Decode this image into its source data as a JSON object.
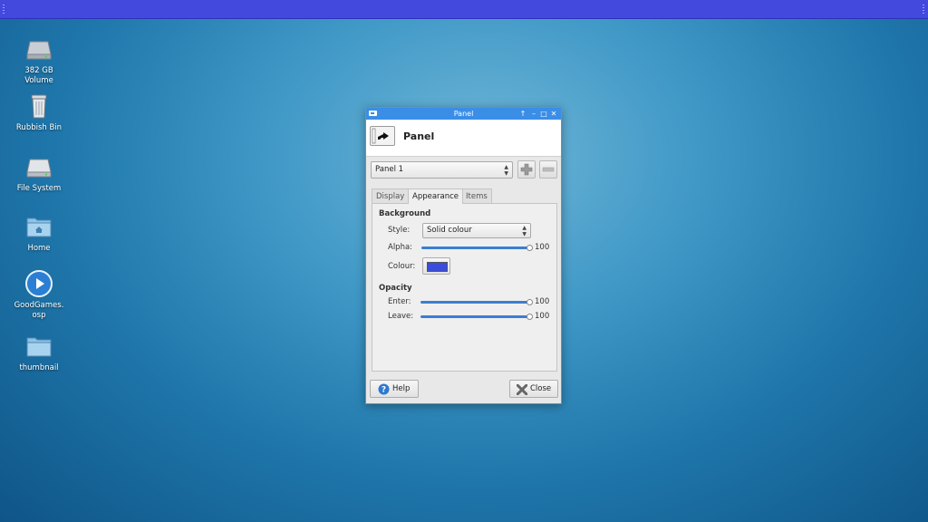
{
  "desktop": {
    "icons": [
      {
        "label": "382 GB\nVolume",
        "line1": "382 GB",
        "line2": "Volume"
      },
      {
        "label": "Rubbish Bin"
      },
      {
        "label": "File System"
      },
      {
        "label": "Home"
      },
      {
        "label": "GoodGames.\nosp",
        "line1": "GoodGames.",
        "line2": "osp"
      },
      {
        "label": "thumbnail"
      }
    ]
  },
  "dialog": {
    "window_title": "Panel",
    "header_title": "Panel",
    "panel_select": "Panel 1",
    "tabs": [
      {
        "label": "Display"
      },
      {
        "label": "Appearance",
        "active": true
      },
      {
        "label": "Items"
      }
    ],
    "background_section": "Background",
    "style_label": "Style:",
    "style_value": "Solid colour",
    "alpha_label": "Alpha:",
    "alpha_value": "100",
    "colour_label": "Colour:",
    "colour_swatch": "#3b4ddb",
    "opacity_section": "Opacity",
    "enter_label": "Enter:",
    "enter_value": "100",
    "leave_label": "Leave:",
    "leave_value": "100",
    "help_label": "Help",
    "close_label": "Close"
  },
  "colors": {
    "top_panel": "#4349dd",
    "titlebar": "#3a8ee6",
    "slider": "#3a7fd0"
  }
}
